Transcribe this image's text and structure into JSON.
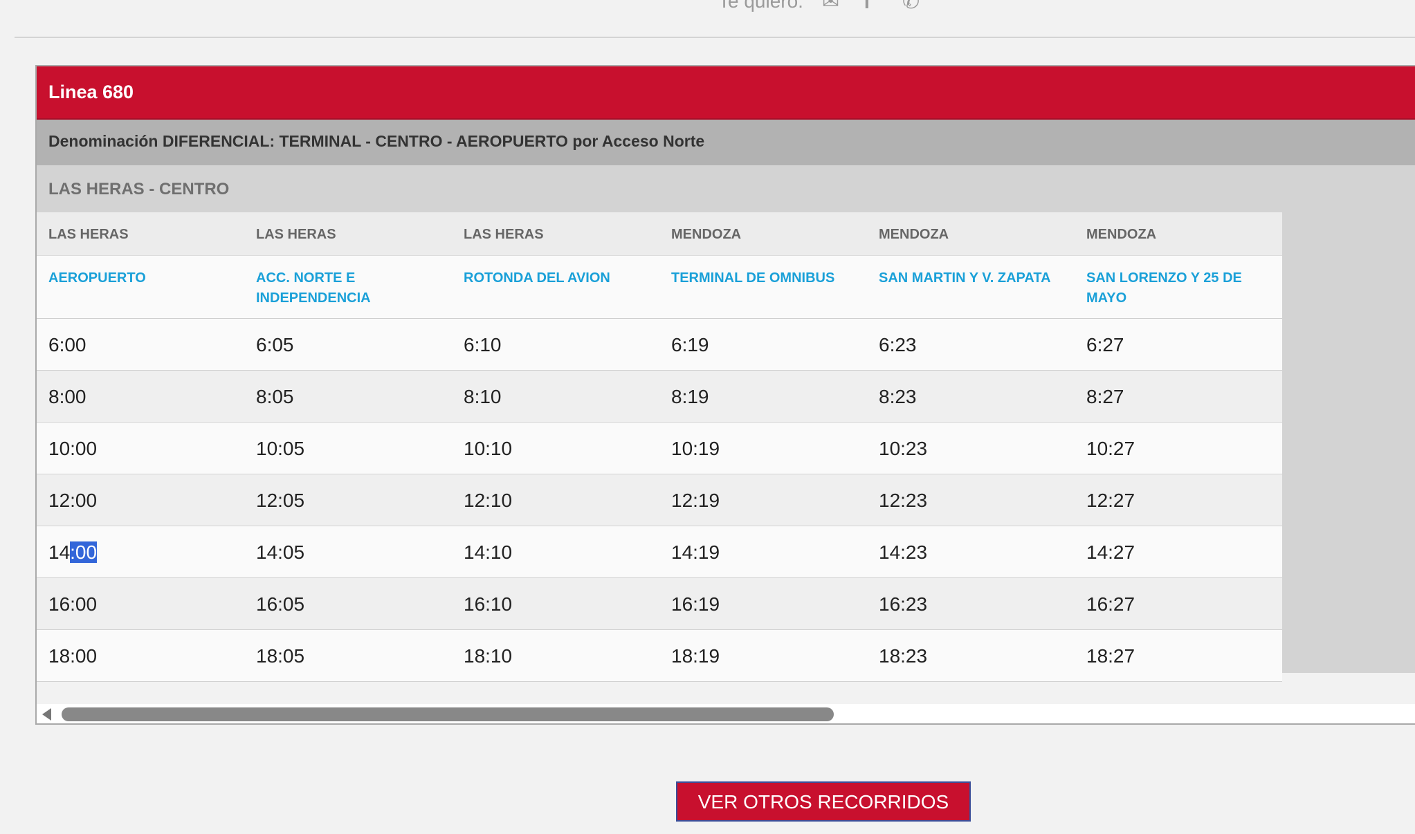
{
  "share": {
    "text": "Te quiero:",
    "icons": [
      "email-icon",
      "facebook-icon",
      "whatsapp-icon"
    ]
  },
  "panel": {
    "title": "Linea 680",
    "denomination": "Denominación DIFERENCIAL: TERMINAL - CENTRO - AEROPUERTO por Acceso Norte",
    "route": "LAS HERAS - CENTRO"
  },
  "table": {
    "localities": [
      "LAS HERAS",
      "LAS HERAS",
      "LAS HERAS",
      "MENDOZA",
      "MENDOZA",
      "MENDOZA"
    ],
    "stops": [
      "AEROPUERTO",
      "ACC. NORTE E INDEPENDENCIA",
      "ROTONDA DEL AVION",
      "TERMINAL DE OMNIBUS",
      "SAN MARTIN Y V. ZAPATA",
      "SAN LORENZO Y 25 DE MAYO"
    ],
    "rows": [
      [
        "6:00",
        "6:05",
        "6:10",
        "6:19",
        "6:23",
        "6:27"
      ],
      [
        "8:00",
        "8:05",
        "8:10",
        "8:19",
        "8:23",
        "8:27"
      ],
      [
        "10:00",
        "10:05",
        "10:10",
        "10:19",
        "10:23",
        "10:27"
      ],
      [
        "12:00",
        "12:05",
        "12:10",
        "12:19",
        "12:23",
        "12:27"
      ],
      [
        "14:00",
        "14:05",
        "14:10",
        "14:19",
        "14:23",
        "14:27"
      ],
      [
        "16:00",
        "16:05",
        "16:10",
        "16:19",
        "16:23",
        "16:27"
      ],
      [
        "18:00",
        "18:05",
        "18:10",
        "18:19",
        "18:23",
        "18:27"
      ]
    ],
    "selection": {
      "row": 4,
      "col": 0,
      "before": "14",
      "selected": ":00"
    }
  },
  "colors": {
    "accent": "#c8102e",
    "stop_link": "#1aa0d8",
    "selection": "#3366d9"
  },
  "buttons": {
    "more_routes": "VER OTROS RECORRIDOS"
  }
}
